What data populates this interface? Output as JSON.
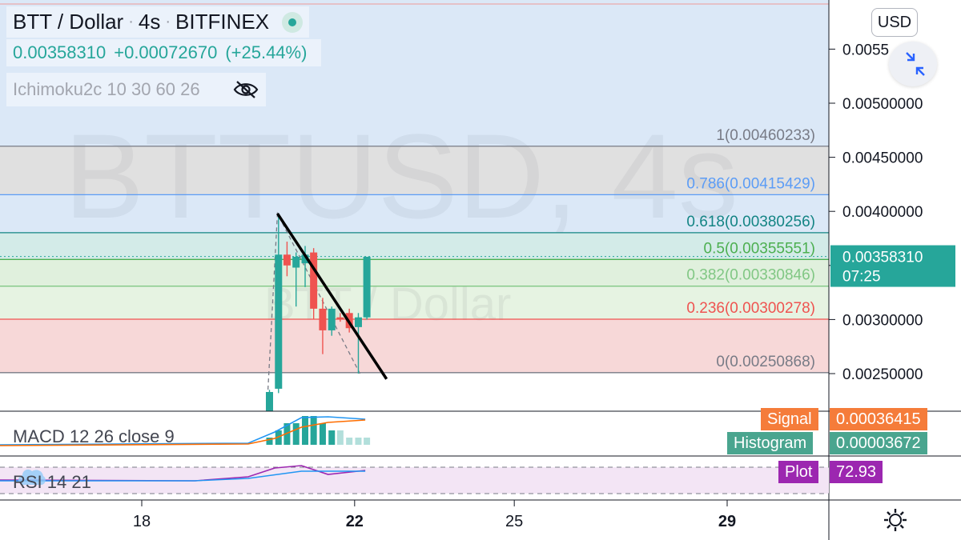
{
  "header": {
    "symbol": "BTT / Dollar",
    "interval": "4s",
    "exchange": "BITFINEX",
    "separator": "·",
    "last_price": "0.00358310",
    "change": "+0.00072670",
    "change_pct": "(+25.44%)",
    "indicator": "Ichimoku2c 10 30 60 26"
  },
  "watermark": "BTTUSD, 4s",
  "watermark_sub": "BTT / Dollar",
  "currency_button": "USD",
  "icons": {
    "collapse": "collapse-arrows-icon",
    "visibility": "eye-slash-icon",
    "settings": "gear-icon",
    "status": "market-open-dot-icon",
    "rsi_logo": "tradingview-cloud-icon"
  },
  "colors": {
    "up": "#26a69a",
    "down": "#ef5350",
    "accent": "#2962ff",
    "rsi": "#7e57c2"
  },
  "chart_data": {
    "type": "candlestick",
    "price_axis": {
      "ticks": [
        "0.00250000",
        "0.00300000",
        "0.00350000",
        "0.00400000",
        "0.00450000",
        "0.00500000",
        "0.0055"
      ]
    },
    "last_price_label": {
      "value": "0.00358310",
      "countdown": "07:25"
    },
    "time_axis": {
      "ticks": [
        "18",
        "22",
        "25",
        "29"
      ]
    },
    "fib_levels": [
      {
        "ratio": "1",
        "price": "0.00460233",
        "label": "1(0.00460233)",
        "color": "#787b86",
        "fill": "#e0e0e0"
      },
      {
        "ratio": "0.786",
        "price": "0.00415429",
        "label": "0.786(0.00415429)",
        "color": "#5b9cf6",
        "fill": "#dbe8f7"
      },
      {
        "ratio": "0.618",
        "price": "0.00380256",
        "label": "0.618(0.00380256)",
        "color": "#138484",
        "fill": "#d3ebe8"
      },
      {
        "ratio": "0.5",
        "price": "0.00355551",
        "label": "0.5(0.00355551)",
        "color": "#4caf50",
        "fill": "#e0f0dd"
      },
      {
        "ratio": "0.382",
        "price": "0.00330846",
        "label": "0.382(0.00330846)",
        "color": "#81c784",
        "fill": "#e6f3e2"
      },
      {
        "ratio": "0.236",
        "price": "0.00300278",
        "label": "0.236(0.00300278)",
        "color": "#ef5350",
        "fill": "#f7d8d8"
      },
      {
        "ratio": "0",
        "price": "0.00250868",
        "label": "0(0.00250868)",
        "color": "#787b86",
        "fill": null
      }
    ],
    "candles": [
      {
        "x": 20.4,
        "o": 0.0021,
        "h": 0.00235,
        "l": 0.00205,
        "c": 0.00233
      },
      {
        "x": 20.57,
        "o": 0.00236,
        "h": 0.00398,
        "l": 0.00232,
        "c": 0.0036
      },
      {
        "x": 20.73,
        "o": 0.0036,
        "h": 0.00372,
        "l": 0.0034,
        "c": 0.0035
      },
      {
        "x": 20.9,
        "o": 0.00348,
        "h": 0.00362,
        "l": 0.00312,
        "c": 0.00358
      },
      {
        "x": 21.07,
        "o": 0.00352,
        "h": 0.00368,
        "l": 0.0033,
        "c": 0.0036
      },
      {
        "x": 21.23,
        "o": 0.00362,
        "h": 0.00366,
        "l": 0.003,
        "c": 0.0031
      },
      {
        "x": 21.4,
        "o": 0.0031,
        "h": 0.0032,
        "l": 0.00268,
        "c": 0.0029
      },
      {
        "x": 21.57,
        "o": 0.0029,
        "h": 0.00312,
        "l": 0.00285,
        "c": 0.0031
      },
      {
        "x": 21.73,
        "o": 0.00302,
        "h": 0.00306,
        "l": 0.00298,
        "c": 0.003
      },
      {
        "x": 21.9,
        "o": 0.00306,
        "h": 0.0031,
        "l": 0.00288,
        "c": 0.00292
      },
      {
        "x": 22.07,
        "o": 0.00293,
        "h": 0.00306,
        "l": 0.0025,
        "c": 0.00302
      },
      {
        "x": 22.23,
        "o": 0.00302,
        "h": 0.00358,
        "l": 0.003,
        "c": 0.00358
      }
    ],
    "trendline": {
      "from": {
        "x": 20.55,
        "y": 0.00398
      },
      "to": {
        "x": 22.6,
        "y": 0.00245
      }
    },
    "macd": {
      "label": "MACD 12 26 close 9",
      "signal_label": "Signal",
      "signal_value": "0.00036415",
      "histogram_label": "Histogram",
      "histogram_value": "0.00003672",
      "histogram": [
        1e-05,
        2e-05,
        3e-05,
        3e-05,
        4e-05,
        4e-05,
        3e-05,
        2e-05,
        2e-05,
        1e-05,
        1e-05,
        1e-05
      ]
    },
    "rsi": {
      "label": "RSI 14 21",
      "plot_label": "Plot",
      "plot_value": "72.93"
    }
  }
}
